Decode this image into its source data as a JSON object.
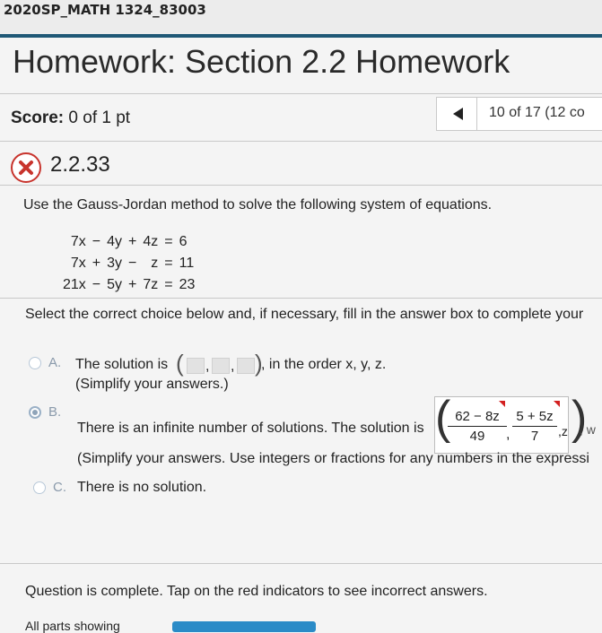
{
  "course": {
    "title": "2020SP_MATH 1324_83003"
  },
  "homework": {
    "title": "Homework: Section 2.2 Homework"
  },
  "score": {
    "label": "Score:",
    "value": "0 of 1 pt"
  },
  "nav": {
    "progress": "10 of 17 (12 co"
  },
  "question": {
    "number": "2.2.33",
    "instructions": "Use the Gauss-Jordan method to solve the following system of equations.",
    "equations": [
      {
        "t1": "7x",
        "op1": "−",
        "t2": "4y",
        "op2": "+",
        "t3": "4z",
        "eq": "=",
        "rhs": "6"
      },
      {
        "t1": "7x",
        "op1": "+",
        "t2": "3y",
        "op2": "−",
        "t3": "z",
        "eq": "=",
        "rhs": "11"
      },
      {
        "t1": "21x",
        "op1": "−",
        "t2": "5y",
        "op2": "+",
        "t3": "7z",
        "eq": "=",
        "rhs": "23"
      }
    ],
    "select_prompt": "Select the correct choice below and, if necessary, fill in the answer box to complete your",
    "options": {
      "a": {
        "letter": "A.",
        "text_before": "The solution is",
        "text_after": ", in the order x, y, z.",
        "note": "(Simplify your answers.)"
      },
      "b": {
        "letter": "B.",
        "text": "There is an infinite number of solutions. The solution is",
        "frac1": {
          "num": "62 − 8z",
          "den": "49"
        },
        "frac2": {
          "num": "5 + 5z",
          "den": "7"
        },
        "tail": ",z",
        "after": ", w",
        "note": "(Simplify your answers. Use integers or fractions for any numbers in the expressi",
        "selected": true
      },
      "c": {
        "letter": "C.",
        "text": "There is no solution."
      }
    },
    "complete_msg": "Question is complete. Tap on the red indicators to see incorrect answers."
  },
  "footer": {
    "text": "All parts showing"
  },
  "colors": {
    "accent": "#1f5876",
    "error": "#c8342d",
    "flag": "#d32020"
  }
}
